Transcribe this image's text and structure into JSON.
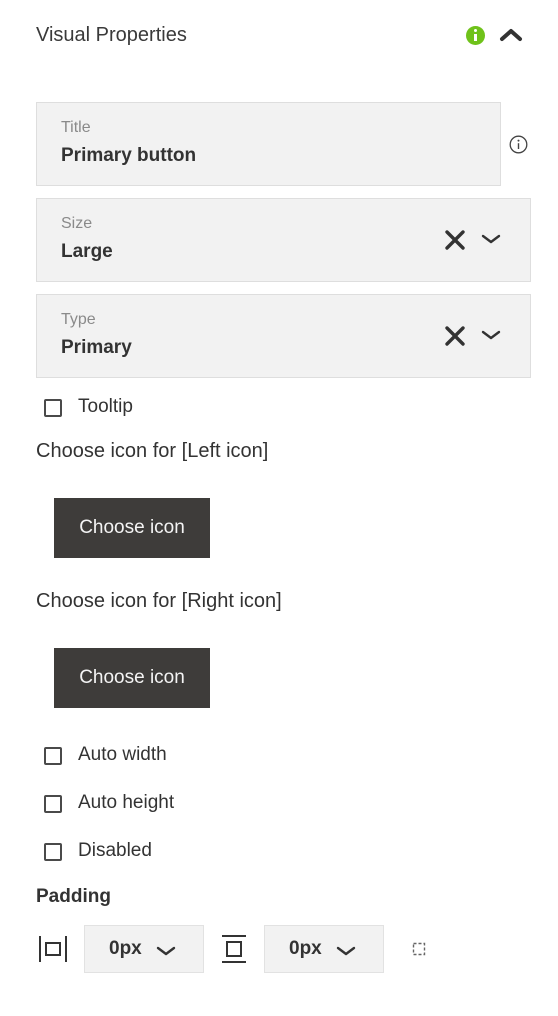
{
  "header": {
    "title": "Visual Properties",
    "status_icon": "info-green-icon",
    "collapse_icon": "chevron-up-icon"
  },
  "fields": {
    "title": {
      "label": "Title",
      "value": "Primary button",
      "help_icon": "info-circle-icon"
    },
    "size": {
      "label": "Size",
      "value": "Large"
    },
    "type": {
      "label": "Type",
      "value": "Primary"
    }
  },
  "checkboxes": {
    "tooltip": "Tooltip",
    "auto_width": "Auto width",
    "auto_height": "Auto height",
    "disabled": "Disabled"
  },
  "left_icon": {
    "label": "Choose icon for [Left icon]",
    "button": "Choose icon"
  },
  "right_icon": {
    "label": "Choose icon for [Right icon]",
    "button": "Choose icon"
  },
  "padding": {
    "label": "Padding",
    "horizontal": "0px",
    "vertical": "0px"
  },
  "colors": {
    "accent_green": "#6fc21a",
    "button_dark": "#3e3c3a",
    "field_bg": "#f2f2f2"
  }
}
